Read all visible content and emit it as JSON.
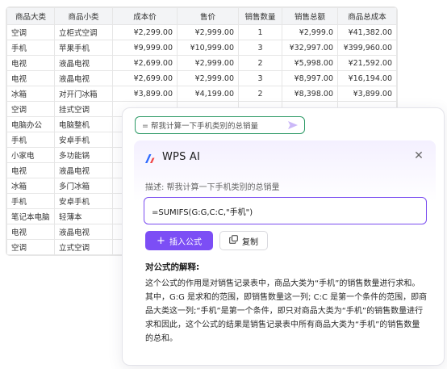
{
  "sheet": {
    "headers": [
      "商品大类",
      "商品小类",
      "成本价",
      "售价",
      "销售数量",
      "销售总额",
      "商品总成本"
    ],
    "rows": [
      [
        "空调",
        "立柜式空调",
        "¥2,299.00",
        "¥2,999.00",
        "1",
        "¥2,999.0",
        "¥41,382.00"
      ],
      [
        "手机",
        "苹果手机",
        "¥9,999.00",
        "¥10,999.00",
        "3",
        "¥32,997.00",
        "¥399,960.00"
      ],
      [
        "电视",
        "液晶电视",
        "¥2,699.00",
        "¥2,999.00",
        "2",
        "¥5,998.00",
        "¥21,592.00"
      ],
      [
        "电视",
        "液晶电视",
        "¥2,699.00",
        "¥2,999.00",
        "3",
        "¥8,997.00",
        "¥16,194.00"
      ],
      [
        "冰箱",
        "对开门冰箱",
        "¥3,899.00",
        "¥4,199.00",
        "2",
        "¥8,398.00",
        "¥3,899.00"
      ],
      [
        "空调",
        "挂式空调",
        "",
        "",
        "",
        "",
        ""
      ],
      [
        "电脑办公",
        "电脑整机",
        "",
        "",
        "",
        "",
        ""
      ],
      [
        "手机",
        "安卓手机",
        "",
        "",
        "",
        "",
        ""
      ],
      [
        "小家电",
        "多功能锅",
        "",
        "",
        "",
        "",
        ""
      ],
      [
        "电视",
        "液晶电视",
        "",
        "",
        "",
        "",
        ""
      ],
      [
        "冰箱",
        "多门冰箱",
        "",
        "",
        "",
        "",
        ""
      ],
      [
        "手机",
        "安卓手机",
        "",
        "",
        "",
        "",
        ""
      ],
      [
        "笔记本电脑",
        "轻薄本",
        "",
        "",
        "",
        "",
        ""
      ],
      [
        "电视",
        "液晶电视",
        "",
        "",
        "",
        "",
        ""
      ],
      [
        "空调",
        "立式空调",
        "",
        "",
        "",
        "",
        ""
      ]
    ]
  },
  "assistant": {
    "prompt_text": "= 帮我计算一下手机类别的总销量",
    "title": "WPS AI",
    "close_glyph": "✕",
    "description": "描述: 帮我计算一下手机类别的总销量",
    "formula": "=SUMIFS(G:G,C:C,\"手机\")",
    "insert_label": "插入公式",
    "insert_glyph": "+",
    "copy_label": "复制",
    "explain_title": "对公式的解释:",
    "explain_text": "这个公式的作用是对销售记录表中，商品大类为“手机”的销售数量进行求和。其中，G:G 是求和的范围，即销售数量这一列; C:C 是第一个条件的范围，即商品大类这一列;“手机”是第一个条件，即只对商品大类为“手机”的销售数量进行求和因此，这个公式的结果是销售记录表中所有商品大类为“手机”的销售数量的总和。"
  },
  "colors": {
    "accent": "#7c4ef5",
    "prompt_border": "#2d9a66",
    "logo_blue": "#2f6bff",
    "logo_red": "#f04848"
  },
  "icons": {
    "send": "send-arrow-icon",
    "logo": "wps-ai-logo-icon",
    "close": "close-icon",
    "copy": "copy-icon"
  }
}
